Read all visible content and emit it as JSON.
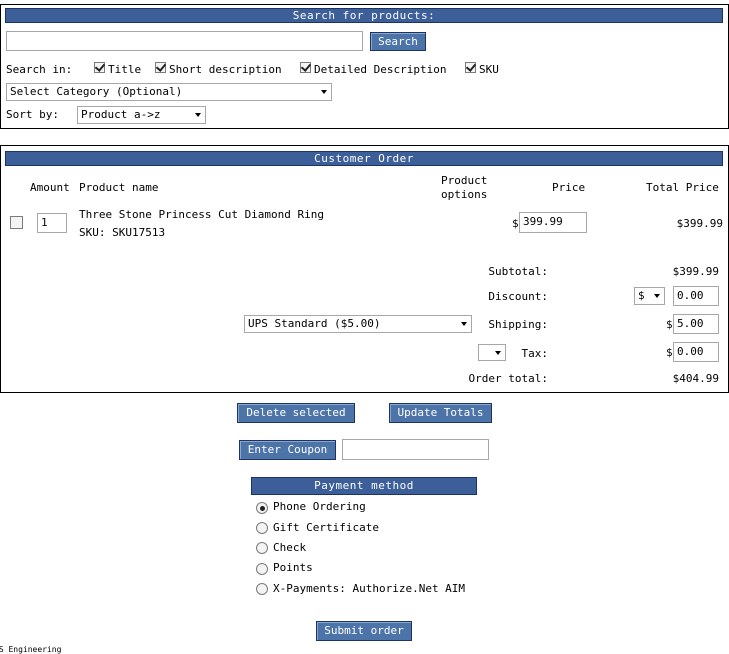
{
  "search": {
    "header": "Search for products:",
    "query": "",
    "button_label": "Search",
    "search_in_label": "Search in:",
    "options": [
      {
        "label": "Title",
        "checked": true
      },
      {
        "label": "Short description",
        "checked": true
      },
      {
        "label": "Detailed Description",
        "checked": true
      },
      {
        "label": "SKU",
        "checked": true
      }
    ],
    "category_selected": "Select Category (Optional)",
    "sort_label": "Sort by:",
    "sort_selected": "Product a->z"
  },
  "order": {
    "header": "Customer Order",
    "columns": {
      "amount": "Amount",
      "product": "Product name",
      "options_line1": "Product",
      "options_line2": "options",
      "price": "Price",
      "total": "Total Price"
    },
    "items": [
      {
        "qty": "1",
        "name": "Three Stone Princess Cut Diamond Ring",
        "sku": "SKU: SKU17513",
        "currency": "$",
        "price": "399.99",
        "total": "$399.99"
      }
    ],
    "subtotal_label": "Subtotal:",
    "subtotal": "$399.99",
    "discount_label": "Discount:",
    "discount_type": "$",
    "discount_value": "0.00",
    "shipping_method": "UPS Standard ($5.00)",
    "shipping_label": "Shipping:",
    "shipping_currency": "$",
    "shipping_value": "5.00",
    "tax_label": "Tax:",
    "tax_currency": "$",
    "tax_value": "0.00",
    "order_total_label": "Order total:",
    "order_total": "$404.99"
  },
  "actions": {
    "delete_label": "Delete selected",
    "update_label": "Update Totals",
    "coupon_label": "Enter Coupon",
    "coupon_value": ""
  },
  "payment": {
    "header": "Payment method",
    "methods": [
      {
        "label": "Phone Ordering",
        "selected": true
      },
      {
        "label": "Gift Certificate",
        "selected": false
      },
      {
        "label": "Check",
        "selected": false
      },
      {
        "label": "Points",
        "selected": false
      },
      {
        "label": "X-Payments: Authorize.Net AIM",
        "selected": false
      }
    ],
    "submit_label": "Submit order"
  },
  "footer": {
    "text": "CS Engineering"
  },
  "colors": {
    "header_bg": "#3c5f99",
    "button_bg": "#4d74a8"
  }
}
